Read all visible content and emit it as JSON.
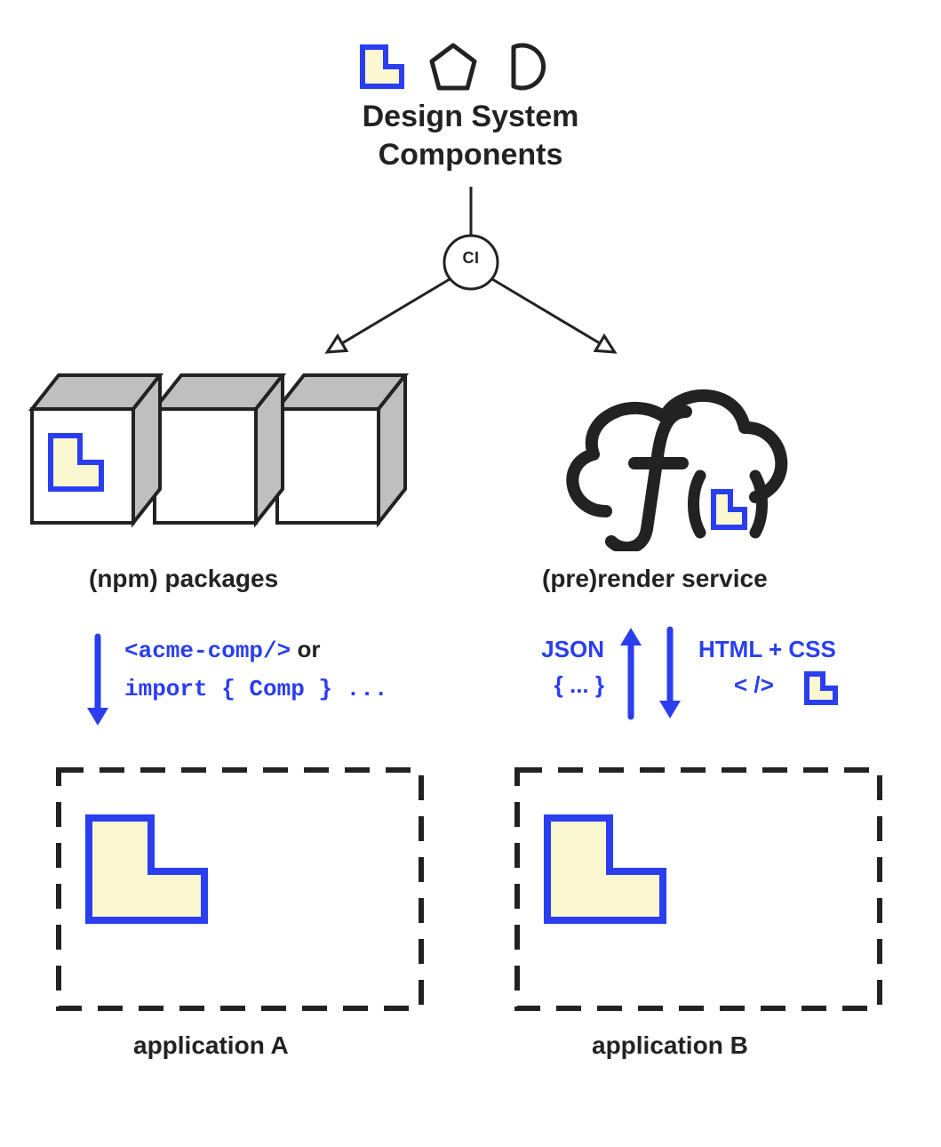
{
  "colors": {
    "ink": "#222222",
    "blue": "#2a3ef0",
    "cream": "#fbf7d0",
    "grey": "#bfbfbf"
  },
  "top": {
    "title_line1": "Design System",
    "title_line2": "Components",
    "ci_label": "CI"
  },
  "left": {
    "label": "(npm) packages",
    "code_line1": "<acme-comp/>",
    "or_word": "or",
    "code_line2": "import { Comp } ...",
    "app_label": "application A"
  },
  "right": {
    "label": "(pre)render service",
    "json_label": "JSON",
    "json_braces": "{ ... }",
    "html_label": "HTML + CSS",
    "selfclose": "< />",
    "app_label": "application B"
  }
}
